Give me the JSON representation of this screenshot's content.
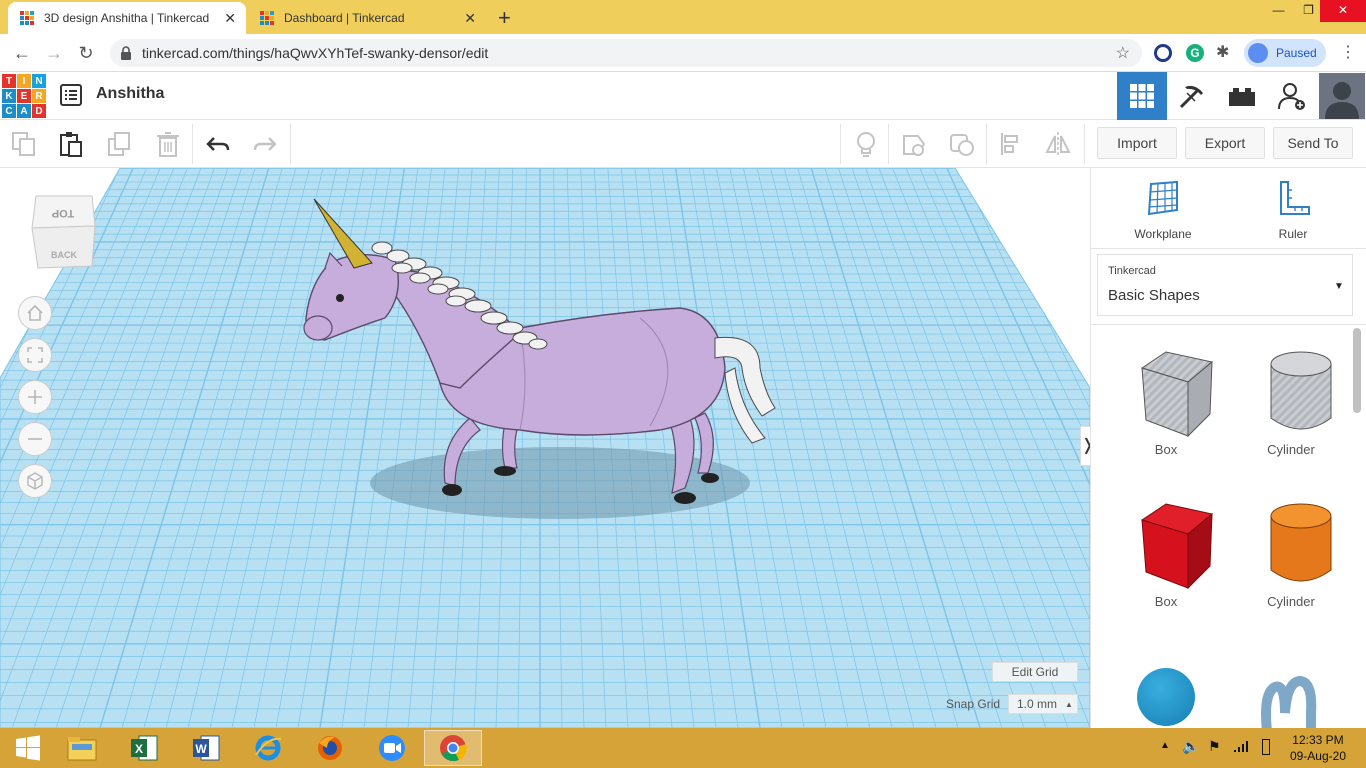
{
  "browser": {
    "tabs": [
      {
        "title": "3D design Anshitha | Tinkercad",
        "active": true
      },
      {
        "title": "Dashboard | Tinkercad",
        "active": false
      }
    ],
    "new_tab_label": "+",
    "url": "tinkercad.com/things/haQwvXYhTef-swanky-densor/edit",
    "profile_label": "Paused"
  },
  "app": {
    "logo_letters": [
      "T",
      "I",
      "N",
      "K",
      "E",
      "R",
      "C",
      "A",
      "D"
    ],
    "logo_colors": [
      "#e4332a",
      "#f5a623",
      "#17a2df",
      "#1b8ec9",
      "#e4332a",
      "#f5a623",
      "#1b8ec9",
      "#1b8ec9",
      "#e4332a"
    ],
    "design_name": "Anshitha"
  },
  "toolbar": {
    "import_label": "Import",
    "export_label": "Export",
    "sendto_label": "Send To"
  },
  "viewcube": {
    "top_label": "TOP",
    "back_label": "BACK"
  },
  "grid": {
    "edit_grid_label": "Edit Grid",
    "snap_grid_label": "Snap Grid",
    "snap_grid_value": "1.0 mm"
  },
  "panel": {
    "workplane_label": "Workplane",
    "ruler_label": "Ruler",
    "category_header": "Tinkercad",
    "category_value": "Basic Shapes",
    "shapes": [
      {
        "name": "Box",
        "color": "#bfc3c9"
      },
      {
        "name": "Cylinder",
        "color": "#bfc3c9"
      },
      {
        "name": "Box",
        "color": "#d4111d"
      },
      {
        "name": "Cylinder",
        "color": "#e4781a"
      }
    ]
  },
  "taskbar": {
    "time": "12:33 PM",
    "date": "09-Aug-20"
  },
  "colors": {
    "grid_bg": "#b7e0f3",
    "grid_line": "#7cc4e8",
    "accent": "#2f7fc9",
    "unicorn_body": "#c6addb",
    "horn": "#d2b232"
  }
}
